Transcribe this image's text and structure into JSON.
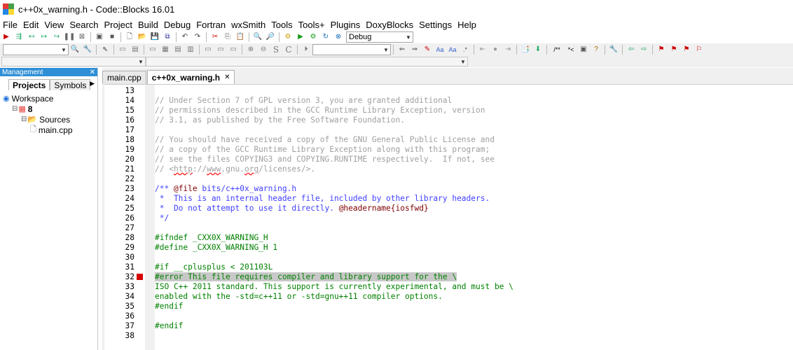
{
  "window": {
    "title": "c++0x_warning.h - Code::Blocks 16.01"
  },
  "menu": [
    "File",
    "Edit",
    "View",
    "Search",
    "Project",
    "Build",
    "Debug",
    "Fortran",
    "wxSmith",
    "Tools",
    "Tools+",
    "Plugins",
    "DoxyBlocks",
    "Settings",
    "Help"
  ],
  "toolbar": {
    "build_target": "Debug",
    "search_text": "",
    "code_scope": "",
    "symbol_select": ""
  },
  "management": {
    "title": "Management",
    "close_glyph": "✕",
    "tabs": [
      "Projects",
      "Symbols"
    ],
    "tree": [
      {
        "label": "Workspace",
        "indent": 0,
        "icon": "workspace-icon"
      },
      {
        "label": "8",
        "indent": 1,
        "icon": "project-icon",
        "bold": true
      },
      {
        "label": "Sources",
        "indent": 2,
        "icon": "folder-icon"
      },
      {
        "label": "main.cpp",
        "indent": 3,
        "icon": "file-icon"
      }
    ]
  },
  "editor": {
    "tabs": [
      {
        "label": "main.cpp",
        "active": false
      },
      {
        "label": "c++0x_warning.h",
        "active": true,
        "close": "✕"
      }
    ],
    "lines": [
      {
        "n": "13",
        "segs": []
      },
      {
        "n": "14",
        "segs": [
          {
            "t": "// Under Section 7 of GPL version 3, you are granted additional",
            "c": "c-comment"
          }
        ]
      },
      {
        "n": "15",
        "segs": [
          {
            "t": "// permissions described in the GCC Runtime Library Exception, version",
            "c": "c-comment"
          }
        ]
      },
      {
        "n": "16",
        "segs": [
          {
            "t": "// 3.1, as published by the Free Software Foundation.",
            "c": "c-comment"
          }
        ]
      },
      {
        "n": "17",
        "segs": []
      },
      {
        "n": "18",
        "segs": [
          {
            "t": "// You should have received a copy of the GNU General Public License and",
            "c": "c-comment"
          }
        ]
      },
      {
        "n": "19",
        "segs": [
          {
            "t": "// a copy of the GCC Runtime Library Exception along with this program;",
            "c": "c-comment"
          }
        ]
      },
      {
        "n": "20",
        "segs": [
          {
            "t": "// see the files COPYING3 and COPYING.RUNTIME respectively.  If not, see",
            "c": "c-comment"
          }
        ]
      },
      {
        "n": "21",
        "segs": [
          {
            "t": "// <",
            "c": "c-comment"
          },
          {
            "t": "http",
            "c": "c-comment c-link"
          },
          {
            "t": "://",
            "c": "c-comment"
          },
          {
            "t": "www",
            "c": "c-comment c-link"
          },
          {
            "t": ".gnu.",
            "c": "c-comment"
          },
          {
            "t": "org",
            "c": "c-comment c-link"
          },
          {
            "t": "/licenses/>.",
            "c": "c-comment"
          }
        ]
      },
      {
        "n": "22",
        "segs": []
      },
      {
        "n": "23",
        "segs": [
          {
            "t": "/** ",
            "c": "c-doc"
          },
          {
            "t": "@file",
            "c": "c-doctag"
          },
          {
            "t": " bits/c++0x_warning.h",
            "c": "c-doc"
          }
        ]
      },
      {
        "n": "24",
        "segs": [
          {
            "t": " *  This is an internal header file, included by other library headers.",
            "c": "c-doc"
          }
        ]
      },
      {
        "n": "25",
        "segs": [
          {
            "t": " *  Do not attempt to use it directly. ",
            "c": "c-doc"
          },
          {
            "t": "@headername",
            "c": "c-doctag"
          },
          {
            "t": "{iosfwd}",
            "c": "c-doctag"
          }
        ]
      },
      {
        "n": "26",
        "segs": [
          {
            "t": " */",
            "c": "c-doc"
          }
        ]
      },
      {
        "n": "27",
        "segs": []
      },
      {
        "n": "28",
        "segs": [
          {
            "t": "#ifndef _CXX0X_WARNING_H",
            "c": "c-pre"
          }
        ]
      },
      {
        "n": "29",
        "segs": [
          {
            "t": "#define _CXX0X_WARNING_H 1",
            "c": "c-pre"
          }
        ]
      },
      {
        "n": "30",
        "segs": []
      },
      {
        "n": "31",
        "segs": [
          {
            "t": "#if __cplusplus < 201103L",
            "c": "c-pre"
          }
        ]
      },
      {
        "n": "32",
        "segs": [
          {
            "t": "#error This file requires compiler and library support for the \\",
            "c": "c-pre hl"
          }
        ],
        "error": true
      },
      {
        "n": "33",
        "segs": [
          {
            "t": "ISO C++ 2011 standard. This support is currently experimental, and must be \\",
            "c": "c-pre"
          }
        ]
      },
      {
        "n": "34",
        "segs": [
          {
            "t": "enabled with the -std=c++11 or -std=gnu++11 compiler options.",
            "c": "c-pre"
          }
        ]
      },
      {
        "n": "35",
        "segs": [
          {
            "t": "#endif",
            "c": "c-pre"
          }
        ]
      },
      {
        "n": "36",
        "segs": []
      },
      {
        "n": "37",
        "segs": [
          {
            "t": "#endif",
            "c": "c-pre"
          }
        ]
      },
      {
        "n": "38",
        "segs": []
      }
    ]
  }
}
